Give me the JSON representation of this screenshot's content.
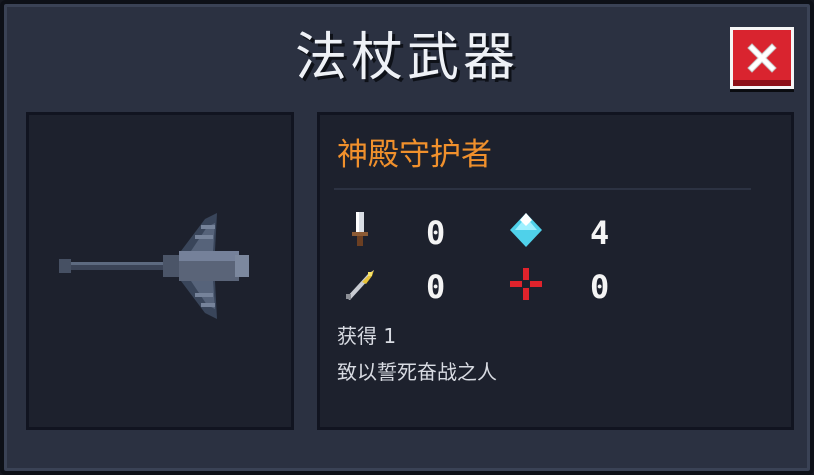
{
  "dialog": {
    "title": "法杖武器",
    "close_icon": "close-x-icon"
  },
  "weapon": {
    "name": "神殿守护者",
    "icon": "staff-weapon-icon",
    "stats": [
      {
        "icon": "sword-damage-icon",
        "value": "0"
      },
      {
        "icon": "blue-crystal-mana-icon",
        "value": "4"
      },
      {
        "icon": "quill-crit-icon",
        "value": "0"
      },
      {
        "icon": "red-crosshair-inaccuracy-icon",
        "value": "0"
      }
    ],
    "obtained": "获得 1",
    "description": "致以誓死奋战之人"
  },
  "colors": {
    "title": "#eef1f6",
    "weapon_name": "#f0902c",
    "close_button": "#d9242f",
    "panel_bg": "#1d212d",
    "dialog_bg": "#2b3141"
  }
}
